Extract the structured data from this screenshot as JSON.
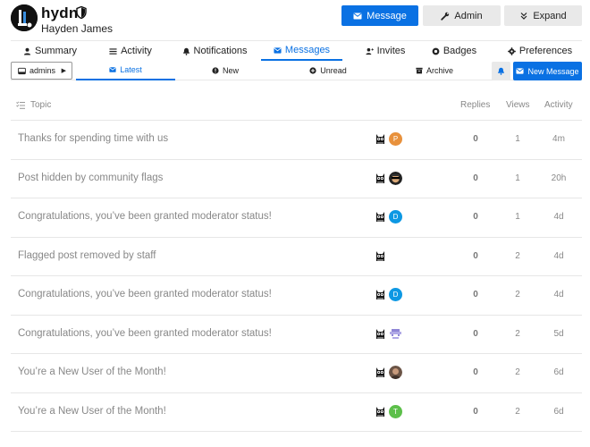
{
  "profile": {
    "username": "hydn",
    "full_name": "Hayden James"
  },
  "header_buttons": {
    "message": "Message",
    "admin": "Admin",
    "expand": "Expand"
  },
  "nav": {
    "summary": "Summary",
    "activity": "Activity",
    "notifications": "Notifications",
    "messages": "Messages",
    "invites": "Invites",
    "badges": "Badges",
    "preferences": "Preferences",
    "active": "messages"
  },
  "subnav": {
    "group_selector": "admins",
    "latest": "Latest",
    "new": "New",
    "unread": "Unread",
    "archive": "Archive",
    "new_message": "New Message",
    "active": "latest"
  },
  "table": {
    "headers": {
      "topic": "Topic",
      "replies": "Replies",
      "views": "Views",
      "activity": "Activity"
    },
    "rows": [
      {
        "title": "Thanks for spending time with us",
        "posters": [
          {
            "type": "owl"
          },
          {
            "type": "letter",
            "letter": "P",
            "color": "#e8913c"
          }
        ],
        "replies": "0",
        "views": "1",
        "activity": "4m"
      },
      {
        "title": "Post hidden by community flags",
        "posters": [
          {
            "type": "owl"
          },
          {
            "type": "shades"
          }
        ],
        "replies": "0",
        "views": "1",
        "activity": "20h"
      },
      {
        "title": "Congratulations, you’ve been granted moderator status!",
        "posters": [
          {
            "type": "owl"
          },
          {
            "type": "letter",
            "letter": "D",
            "color": "#0d98e3"
          }
        ],
        "replies": "0",
        "views": "1",
        "activity": "4d"
      },
      {
        "title": "Flagged post removed by staff",
        "posters": [
          {
            "type": "owl"
          }
        ],
        "replies": "0",
        "views": "2",
        "activity": "4d"
      },
      {
        "title": "Congratulations, you’ve been granted moderator status!",
        "posters": [
          {
            "type": "owl"
          },
          {
            "type": "letter",
            "letter": "D",
            "color": "#0d98e3"
          }
        ],
        "replies": "0",
        "views": "2",
        "activity": "4d"
      },
      {
        "title": "Congratulations, you’ve been granted moderator status!",
        "posters": [
          {
            "type": "owl"
          },
          {
            "type": "pixel"
          }
        ],
        "replies": "0",
        "views": "2",
        "activity": "5d"
      },
      {
        "title": "You’re a New User of the Month!",
        "posters": [
          {
            "type": "owl"
          },
          {
            "type": "photo"
          }
        ],
        "replies": "0",
        "views": "2",
        "activity": "6d"
      },
      {
        "title": "You’re a New User of the Month!",
        "posters": [
          {
            "type": "owl"
          },
          {
            "type": "letter",
            "letter": "T",
            "color": "#5cbf4a"
          }
        ],
        "replies": "0",
        "views": "2",
        "activity": "6d"
      }
    ]
  },
  "colors": {
    "accent": "#0a71e3",
    "muted_text": "#888888",
    "button_gray": "#e9e9e9"
  }
}
